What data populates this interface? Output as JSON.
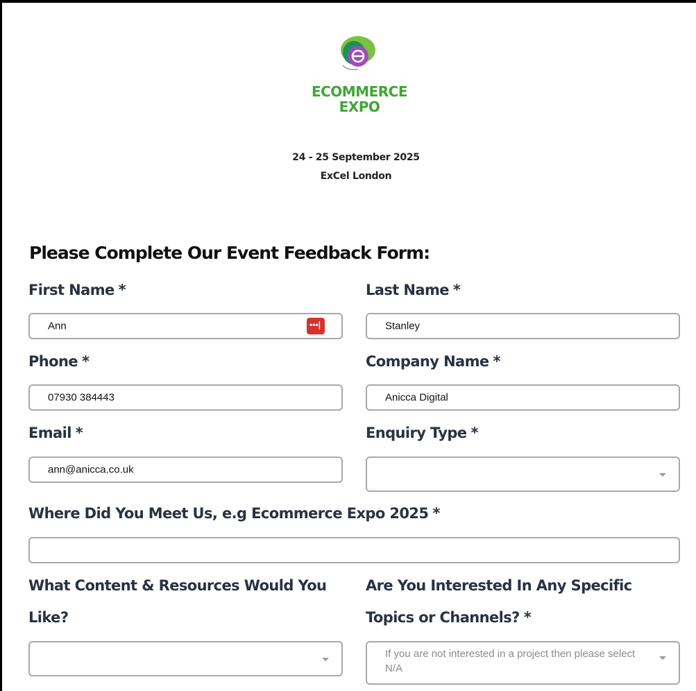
{
  "brand": {
    "line1": "ECOMMERCE",
    "line2": "EXPO"
  },
  "event": {
    "dates": "24 - 25 September 2025",
    "venue": "ExCel London"
  },
  "form": {
    "title": "Please Complete Our Event Feedback Form:",
    "first_name": {
      "label": "First Name",
      "value": "Ann"
    },
    "last_name": {
      "label": "Last Name",
      "value": "Stanley"
    },
    "phone": {
      "label": "Phone",
      "value": "07930 384443"
    },
    "company": {
      "label": "Company Name",
      "value": "Anicca Digital"
    },
    "email": {
      "label": "Email",
      "value": "ann@anicca.co.uk"
    },
    "enquiry": {
      "label": "Enquiry Type",
      "value": ""
    },
    "meet": {
      "label": "Where Did You Meet Us, e.g Ecommerce Expo 2025",
      "value": ""
    },
    "content": {
      "label_line1": "What Content & Resources Would You",
      "label_line2": "Like?",
      "value": ""
    },
    "topics": {
      "label_line1": "Are You Interested In Any Specific",
      "label_line2": "Topics or Channels?",
      "placeholder_line1": "If you are not interested in a project then please select",
      "placeholder_line2": "N/A"
    },
    "required_mark": "*",
    "password_icon_text": "•••|"
  },
  "colors": {
    "brand_green": "#3fa535",
    "label": "#2a3241",
    "password_icon": "#d8312c"
  }
}
